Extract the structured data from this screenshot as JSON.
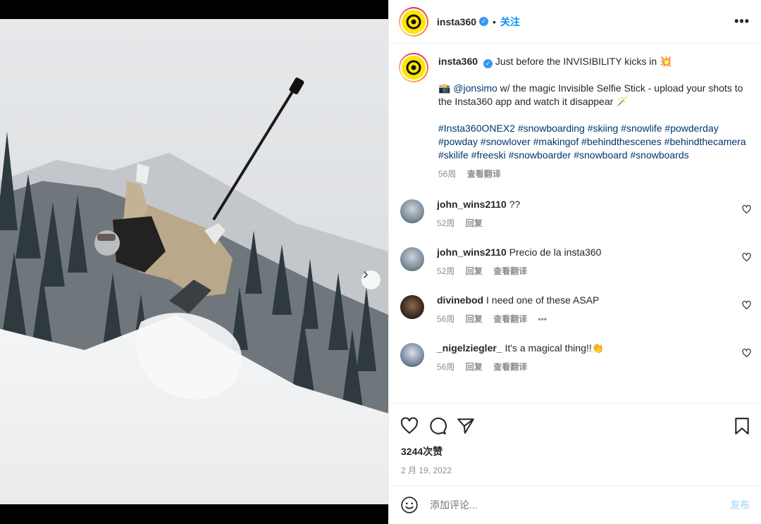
{
  "post": {
    "username": "insta360",
    "follow_label": "关注",
    "more_label": "•••",
    "separator": "•"
  },
  "caption": {
    "username": "insta360",
    "line1": "Just before the INVISIBILITY kicks in 💥",
    "mention": "@jonsimo",
    "line2": " w/ the magic Invisible Selfie Stick - upload your shots to the Insta360 app and watch it disappear 🪄",
    "camera_emoji": "📸",
    "hashtags": "#Insta360ONEX2 #snowboarding #skiing #snowlife #powderday #powday #snowlover #makingof #behindthescenes #behindthecamera #skilife #freeski #snowboarder #snowboard #snowboards",
    "age": "56周",
    "translate": "查看翻译"
  },
  "comments": [
    {
      "username": "john_wins2110",
      "text": "??",
      "age": "52周",
      "reply": "回复",
      "translate": ""
    },
    {
      "username": "john_wins2110",
      "text": "Precio de la insta360",
      "age": "52周",
      "reply": "回复",
      "translate": "查看翻译"
    },
    {
      "username": "divinebod",
      "text": "I need one of these ASAP",
      "age": "56周",
      "reply": "回复",
      "translate": "查看翻译",
      "more": "•••"
    },
    {
      "username": "_nigelziegler_",
      "text": "It's a magical thing!!👏",
      "age": "56周",
      "reply": "回复",
      "translate": "查看翻译"
    }
  ],
  "stats": {
    "likes": "3244次赞",
    "date": "2 月 19, 2022"
  },
  "composer": {
    "placeholder": "添加评论...",
    "post_label": "发布"
  },
  "carousel": {
    "total": 4,
    "active": 1
  },
  "colors": {
    "accent": "#0095f6",
    "verified": "#3897f0",
    "brand_yellow": "#ffe600"
  }
}
